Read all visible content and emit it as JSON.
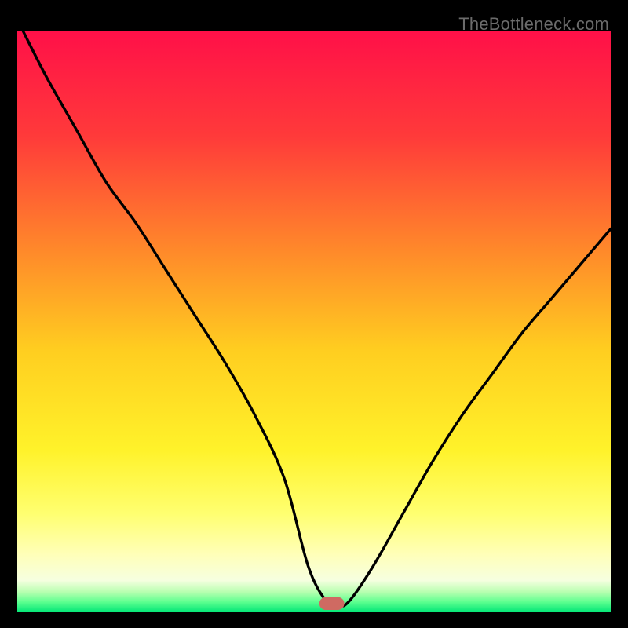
{
  "watermark": "TheBottleneck.com",
  "chart_data": {
    "type": "line",
    "title": "",
    "xlabel": "",
    "ylabel": "",
    "xlim": [
      0,
      100
    ],
    "ylim": [
      0,
      100
    ],
    "gradient_stops": [
      {
        "offset": 0.0,
        "color": "#ff1048"
      },
      {
        "offset": 0.18,
        "color": "#ff3a3a"
      },
      {
        "offset": 0.38,
        "color": "#ff8a2a"
      },
      {
        "offset": 0.55,
        "color": "#ffce20"
      },
      {
        "offset": 0.72,
        "color": "#fff22a"
      },
      {
        "offset": 0.83,
        "color": "#ffff70"
      },
      {
        "offset": 0.9,
        "color": "#ffffb8"
      },
      {
        "offset": 0.945,
        "color": "#f6ffe0"
      },
      {
        "offset": 0.965,
        "color": "#b8ffb0"
      },
      {
        "offset": 0.982,
        "color": "#5eff90"
      },
      {
        "offset": 1.0,
        "color": "#00e676"
      }
    ],
    "series": [
      {
        "name": "curve",
        "x": [
          1,
          5,
          10,
          15,
          20,
          25,
          30,
          35,
          40,
          45,
          49,
          52,
          54,
          56,
          60,
          65,
          70,
          75,
          80,
          85,
          90,
          95,
          100
        ],
        "y": [
          100,
          92,
          83,
          74,
          67,
          59,
          51,
          43,
          34,
          23,
          8,
          2,
          1,
          2,
          8,
          17,
          26,
          34,
          41,
          48,
          54,
          60,
          66
        ]
      }
    ],
    "marker": {
      "x": 53,
      "y": 1.5,
      "w": 4.2,
      "h": 2.2,
      "rx": 1.1,
      "color": "#cf6a62"
    }
  }
}
